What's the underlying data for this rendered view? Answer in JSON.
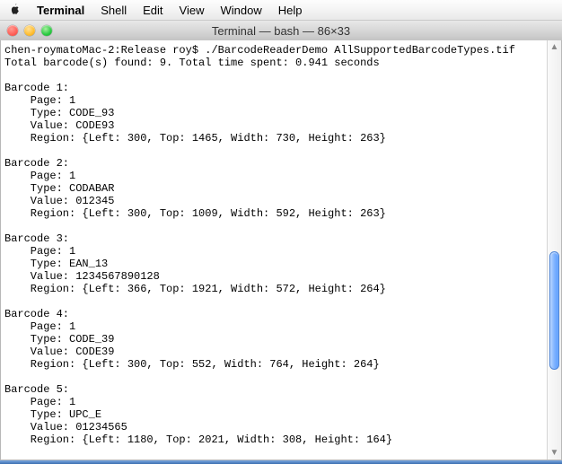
{
  "menubar": {
    "appname": "Terminal",
    "items": [
      "Shell",
      "Edit",
      "View",
      "Window",
      "Help"
    ]
  },
  "window": {
    "title": "Terminal — bash — 86×33"
  },
  "terminal": {
    "prompt": "chen-roymatoMac-2:Release roy$ ",
    "command": "./BarcodeReaderDemo AllSupportedBarcodeTypes.tif",
    "summary": "Total barcode(s) found: 9. Total time spent: 0.941 seconds",
    "barcodes": [
      {
        "header": "Barcode 1:",
        "page": "    Page: 1",
        "type": "    Type: CODE_93",
        "value": "    Value: CODE93",
        "region": "    Region: {Left: 300, Top: 1465, Width: 730, Height: 263}"
      },
      {
        "header": "Barcode 2:",
        "page": "    Page: 1",
        "type": "    Type: CODABAR",
        "value": "    Value: 012345",
        "region": "    Region: {Left: 300, Top: 1009, Width: 592, Height: 263}"
      },
      {
        "header": "Barcode 3:",
        "page": "    Page: 1",
        "type": "    Type: EAN_13",
        "value": "    Value: 1234567890128",
        "region": "    Region: {Left: 366, Top: 1921, Width: 572, Height: 264}"
      },
      {
        "header": "Barcode 4:",
        "page": "    Page: 1",
        "type": "    Type: CODE_39",
        "value": "    Value: CODE39",
        "region": "    Region: {Left: 300, Top: 552, Width: 764, Height: 264}"
      },
      {
        "header": "Barcode 5:",
        "page": "    Page: 1",
        "type": "    Type: UPC_E",
        "value": "    Value: 01234565",
        "region": "    Region: {Left: 1180, Top: 2021, Width: 308, Height: 164}"
      }
    ]
  }
}
